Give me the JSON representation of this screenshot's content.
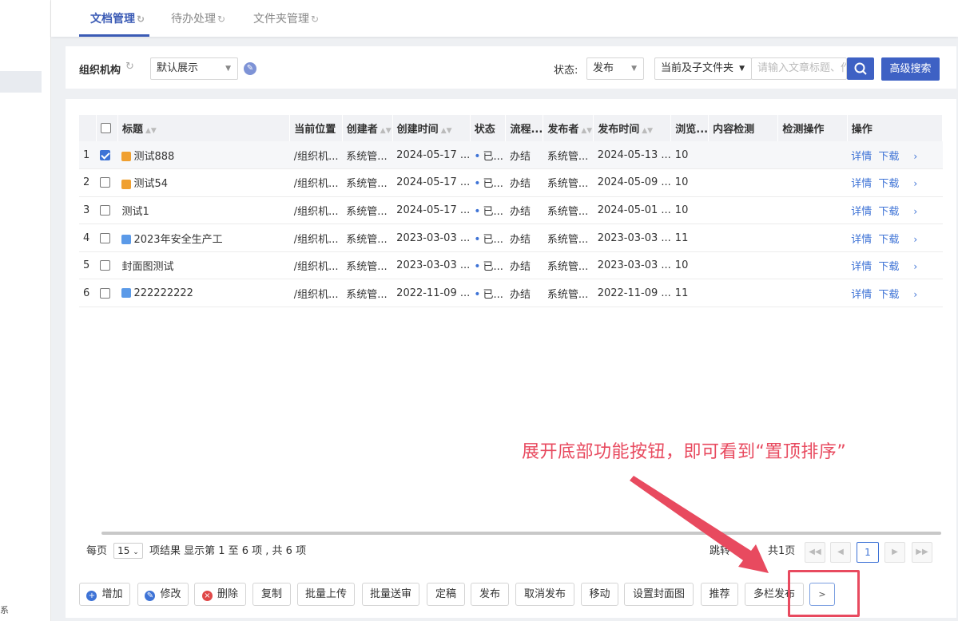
{
  "sidebar": {
    "bottom_char": "系"
  },
  "tabs": [
    {
      "label": "文档管理"
    },
    {
      "label": "待办处理"
    },
    {
      "label": "文件夹管理"
    }
  ],
  "filter": {
    "org_label": "组织机构",
    "view_select": "默认展示",
    "status_label": "状态:",
    "status_select": "发布",
    "scope_select": "当前及子文件夹",
    "search_placeholder": "请输入文章标题、作",
    "advanced_search": "高级搜索"
  },
  "table": {
    "columns": [
      "标题",
      "当前位置",
      "创建者",
      "创建时间",
      "状态",
      "流程...",
      "发布者",
      "发布时间",
      "浏览...",
      "内容检测",
      "检测操作",
      "操作"
    ],
    "rows": [
      {
        "no": "1",
        "checked": true,
        "icon": "orange",
        "title": "测试888",
        "location": "/组织机...",
        "creator": "系统管...",
        "created": "2024-05-17 ...",
        "status": "已...",
        "flow": "办结",
        "publisher": "系统管...",
        "published": "2024-05-13 ...",
        "views": "10"
      },
      {
        "no": "2",
        "checked": false,
        "icon": "orange",
        "title": "测试54",
        "location": "/组织机...",
        "creator": "系统管...",
        "created": "2024-05-17 ...",
        "status": "已...",
        "flow": "办结",
        "publisher": "系统管...",
        "published": "2024-05-09 ...",
        "views": "10"
      },
      {
        "no": "3",
        "checked": false,
        "icon": "",
        "title": "测试1",
        "location": "/组织机...",
        "creator": "系统管...",
        "created": "2024-05-17 ...",
        "status": "已...",
        "flow": "办结",
        "publisher": "系统管...",
        "published": "2024-05-01 ...",
        "views": "10"
      },
      {
        "no": "4",
        "checked": false,
        "icon": "blue",
        "title": "2023年安全生产工",
        "location": "/组织机...",
        "creator": "系统管...",
        "created": "2023-03-03 ...",
        "status": "已...",
        "flow": "办结",
        "publisher": "系统管...",
        "published": "2023-03-03 ...",
        "views": "11"
      },
      {
        "no": "5",
        "checked": false,
        "icon": "",
        "title": "封面图测试",
        "location": "/组织机...",
        "creator": "系统管...",
        "created": "2023-03-03 ...",
        "status": "已...",
        "flow": "办结",
        "publisher": "系统管...",
        "published": "2023-03-03 ...",
        "views": "10"
      },
      {
        "no": "6",
        "checked": false,
        "icon": "blue",
        "title": "222222222",
        "location": "/组织机...",
        "creator": "系统管...",
        "created": "2022-11-09 ...",
        "status": "已...",
        "flow": "办结",
        "publisher": "系统管...",
        "published": "2022-11-09 ...",
        "views": "11"
      }
    ],
    "action_detail": "详情",
    "action_download": "下载"
  },
  "pager": {
    "per_page_label": "每页",
    "per_page_value": "15",
    "summary": "项结果 显示第 1 至 6 项 , 共 6 项",
    "jump_label": "跳转",
    "total_pages": "共1页",
    "current_page": "1"
  },
  "toolbar": [
    {
      "label": "增加",
      "icon": "plus-icon"
    },
    {
      "label": "修改",
      "icon": "edit-icon"
    },
    {
      "label": "删除",
      "icon": "delete-icon"
    },
    {
      "label": "复制"
    },
    {
      "label": "批量上传"
    },
    {
      "label": "批量送审"
    },
    {
      "label": "定稿"
    },
    {
      "label": "发布"
    },
    {
      "label": "取消发布"
    },
    {
      "label": "移动"
    },
    {
      "label": "设置封面图"
    },
    {
      "label": "推荐"
    },
    {
      "label": "多栏发布"
    },
    {
      "label": ">"
    }
  ],
  "annotation": {
    "text": "展开底部功能按钮，即可看到“置顶排序”",
    "color": "#e84a5f"
  },
  "colors": {
    "primary": "#3e61c4",
    "link": "#3e73d6",
    "success": "#3d9a2f"
  }
}
